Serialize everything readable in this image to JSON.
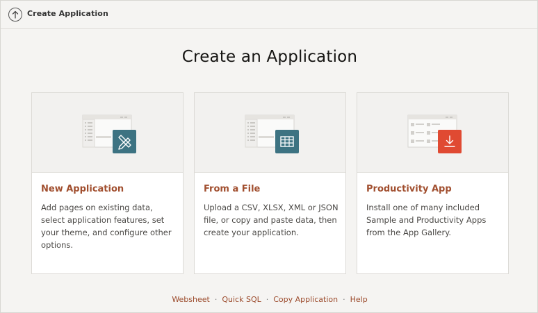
{
  "topbar": {
    "title": "Create Application",
    "up_icon": "arrow-up-circle-icon"
  },
  "page": {
    "title": "Create an Application"
  },
  "cards": [
    {
      "title": "New Application",
      "description": "Add pages on existing data, select application features, set your theme, and configure other options.",
      "badge_icon": "pencil-ruler-icon",
      "badge_color": "#3d7382"
    },
    {
      "title": "From a File",
      "description": "Upload a CSV, XLSX, XML or JSON file, or copy and paste data, then create your application.",
      "badge_icon": "table-grid-icon",
      "badge_color": "#3d7382"
    },
    {
      "title": "Productivity App",
      "description": "Install one of many included Sample and Productivity Apps from the App Gallery.",
      "badge_icon": "download-icon",
      "badge_color": "#e04a32"
    }
  ],
  "footer": {
    "links": [
      "Websheet",
      "Quick SQL",
      "Copy Application",
      "Help"
    ],
    "separator": "·"
  },
  "colors": {
    "accent_text": "#a14f2f",
    "background": "#f5f4f2"
  }
}
